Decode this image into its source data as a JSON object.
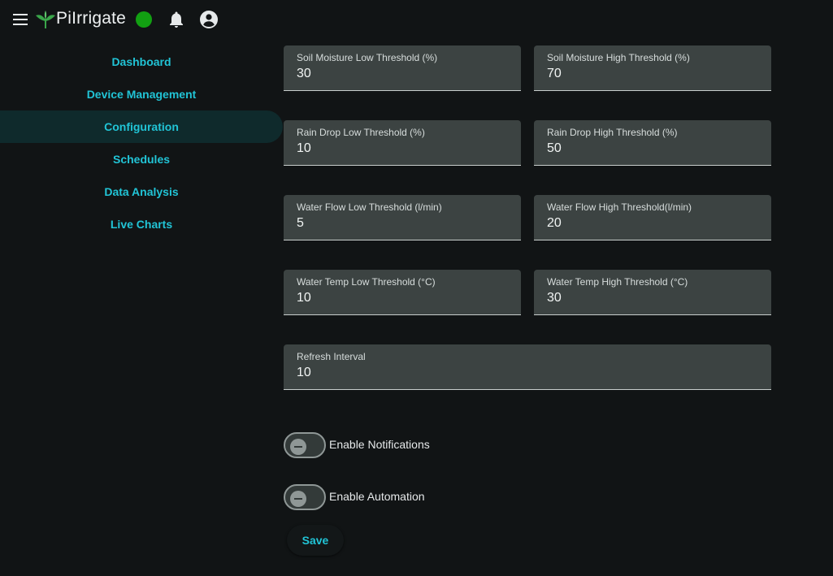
{
  "header": {
    "title": "PiIrrigate",
    "menu_icon": "menu-icon",
    "logo_icon": "sprout-icon",
    "status_color": "#12a012",
    "notification_icon": "bell-icon",
    "account_icon": "account-circle-icon"
  },
  "sidebar": {
    "items": [
      {
        "label": "Dashboard"
      },
      {
        "label": "Device Management"
      },
      {
        "label": "Configuration",
        "active": true
      },
      {
        "label": "Schedules"
      },
      {
        "label": "Data Analysis"
      },
      {
        "label": "Live Charts"
      }
    ]
  },
  "config": {
    "soil_low": {
      "label": "Soil Moisture Low Threshold (%)",
      "value": "30"
    },
    "soil_high": {
      "label": "Soil Moisture High Threshold (%)",
      "value": "70"
    },
    "rain_low": {
      "label": "Rain Drop Low Threshold (%)",
      "value": "10"
    },
    "rain_high": {
      "label": "Rain Drop High Threshold (%)",
      "value": "50"
    },
    "flow_low": {
      "label": "Water Flow Low Threshold (l/min)",
      "value": "5"
    },
    "flow_high": {
      "label": "Water Flow High Threshold(l/min)",
      "value": "20"
    },
    "temp_low": {
      "label": "Water Temp Low Threshold (°C)",
      "value": "10"
    },
    "temp_high": {
      "label": "Water Temp High Threshold (°C)",
      "value": "30"
    },
    "refresh": {
      "label": "Refresh Interval",
      "value": "10"
    }
  },
  "toggles": {
    "notifications": {
      "label": "Enable Notifications",
      "enabled": false
    },
    "automation": {
      "label": "Enable Automation",
      "enabled": false
    }
  },
  "actions": {
    "save_label": "Save"
  },
  "colors": {
    "accent": "#21c4d6",
    "background": "#111415",
    "field": "#3c4342"
  }
}
